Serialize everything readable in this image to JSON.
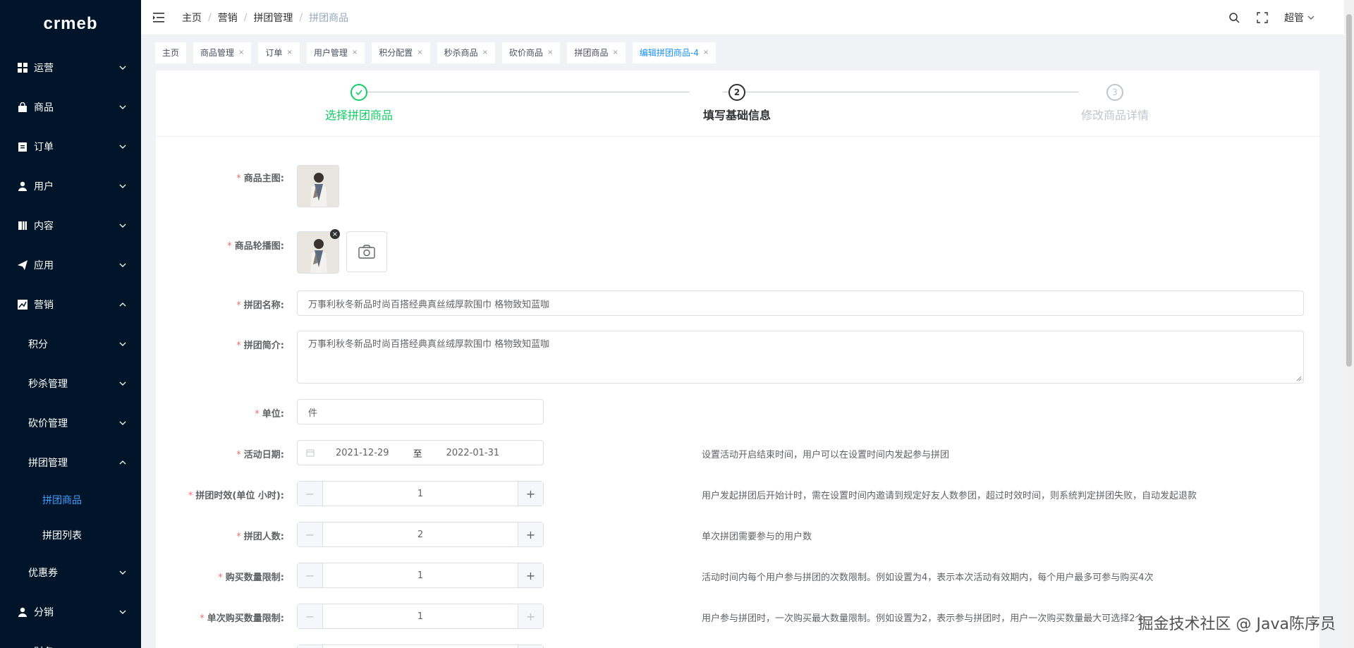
{
  "logo": "crmeb",
  "sidebar": {
    "items": [
      {
        "label": "运营",
        "icon": "grid-icon"
      },
      {
        "label": "商品",
        "icon": "bag-icon"
      },
      {
        "label": "订单",
        "icon": "clipboard-icon"
      },
      {
        "label": "用户",
        "icon": "user-icon"
      },
      {
        "label": "内容",
        "icon": "book-icon"
      },
      {
        "label": "应用",
        "icon": "send-icon"
      },
      {
        "label": "营销",
        "icon": "chart-icon"
      }
    ],
    "marketing_sub": [
      "积分",
      "秒杀管理",
      "砍价管理",
      "拼团管理"
    ],
    "group_leaves": [
      "拼团商品",
      "拼团列表"
    ],
    "after": [
      {
        "label": "优惠券"
      },
      {
        "label": "分销",
        "icon": "user-icon"
      },
      {
        "label": "财务"
      }
    ]
  },
  "breadcrumb": [
    "主页",
    "营销",
    "拼团管理",
    "拼团商品"
  ],
  "user_name": "超管",
  "tags": [
    {
      "label": "主页",
      "closable": false,
      "active": false
    },
    {
      "label": "商品管理",
      "closable": true,
      "active": false
    },
    {
      "label": "订单",
      "closable": true,
      "active": false
    },
    {
      "label": "用户管理",
      "closable": true,
      "active": false
    },
    {
      "label": "积分配置",
      "closable": true,
      "active": false
    },
    {
      "label": "秒杀商品",
      "closable": true,
      "active": false
    },
    {
      "label": "砍价商品",
      "closable": true,
      "active": false
    },
    {
      "label": "拼团商品",
      "closable": true,
      "active": false
    },
    {
      "label": "编辑拼团商品-4",
      "closable": true,
      "active": true
    }
  ],
  "steps": [
    {
      "number": "1",
      "label": "选择拼团商品",
      "status": "done",
      "color": "#13ce66"
    },
    {
      "number": "2",
      "label": "填写基础信息",
      "status": "current",
      "color": "#303133"
    },
    {
      "number": "3",
      "label": "修改商品详情",
      "status": "wait",
      "color": "#c0c4cc"
    }
  ],
  "form": {
    "main_image_label": "商品主图:",
    "carousel_label": "商品轮播图:",
    "name_label": "拼团名称:",
    "name_value": "万事利秋冬新品时尚百搭经典真丝绒厚款围巾 格物致知蓝咖",
    "intro_label": "拼团简介:",
    "intro_value": "万事利秋冬新品时尚百搭经典真丝绒厚款围巾 格物致知蓝咖",
    "unit_label": "单位:",
    "unit_value": "件",
    "date_label": "活动日期:",
    "date_start": "2021-12-29",
    "date_sep": "至",
    "date_end": "2022-01-31",
    "date_help": "设置活动开启结束时间，用户可以在设置时间内发起参与拼团",
    "duration_label": "拼团时效(单位 小时):",
    "duration_value": "1",
    "duration_help": "用户发起拼团后开始计时，需在设置时间内邀请到规定好友人数参团，超过时效时间，则系统判定拼团失败，自动发起退款",
    "people_label": "拼团人数:",
    "people_value": "2",
    "people_help": "单次拼团需要参与的用户数",
    "limit_label": "购买数量限制:",
    "limit_value": "1",
    "limit_help": "活动时间内每个用户参与拼团的次数限制。例如设置为4，表示本次活动有效期内，每个用户最多可参与购买4次",
    "single_label": "单次购买数量限制:",
    "single_value": "1",
    "single_help": "用户参与拼团时，一次购买最大数量限制。例如设置为2，表示参与拼团时，用户一次购买数量最大可选择2个"
  },
  "watermark": "掘金技术社区 @ Java陈序员"
}
